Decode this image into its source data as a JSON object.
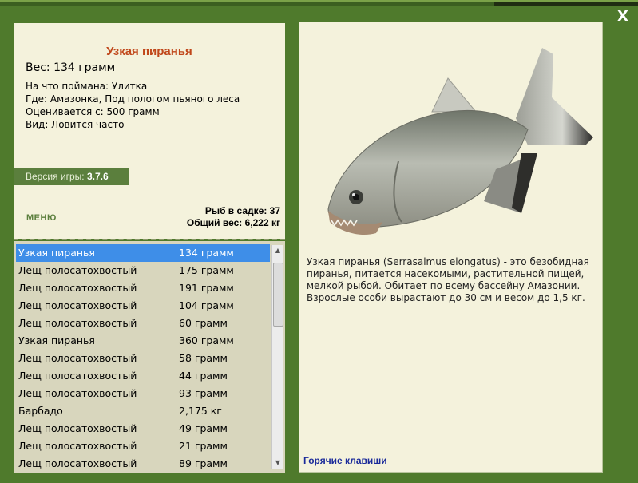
{
  "window": {
    "close_label": "X"
  },
  "fish": {
    "title": "Узкая пиранья",
    "weight": "Вес: 134 грамм",
    "lines": [
      "На что поймана: Улитка",
      "Где: Амазонка, Под пологом пьяного леса",
      "Оценивается с: 500 грамм",
      "Вид: Ловится часто"
    ]
  },
  "version": {
    "label": "Версия игры: ",
    "value": "3.7.6"
  },
  "menu_label": "МЕНЮ",
  "stats": {
    "fish_in_keepnet": "Рыб в садке: 37",
    "total_weight": "Общий вес: 6,222 кг"
  },
  "catch_list": [
    {
      "name": "Узкая пиранья",
      "weight": "134 грамм",
      "selected": true
    },
    {
      "name": "Лещ полосатохвостый",
      "weight": "175 грамм"
    },
    {
      "name": "Лещ полосатохвостый",
      "weight": "191 грамм"
    },
    {
      "name": "Лещ полосатохвостый",
      "weight": "104 грамм"
    },
    {
      "name": "Лещ полосатохвостый",
      "weight": "60 грамм"
    },
    {
      "name": "Узкая пиранья",
      "weight": "360 грамм"
    },
    {
      "name": "Лещ полосатохвостый",
      "weight": "58 грамм"
    },
    {
      "name": "Лещ полосатохвостый",
      "weight": "44 грамм"
    },
    {
      "name": "Лещ полосатохвостый",
      "weight": "93 грамм"
    },
    {
      "name": "Барбадо",
      "weight": "2,175 кг"
    },
    {
      "name": "Лещ полосатохвостый",
      "weight": "49 грамм"
    },
    {
      "name": "Лещ полосатохвостый",
      "weight": "21 грамм"
    },
    {
      "name": "Лещ полосатохвостый",
      "weight": "89 грамм"
    }
  ],
  "description": "Узкая пиранья (Serrasalmus elongatus) - это безобидная пиранья, питается насекомыми, растительной пищей, мелкой рыбой. Обитает по всему бассейну Амазонии. Взрослые особи вырастают до 30 см и весом до 1,5 кг.",
  "hotkeys_label": "Горячие клавиши",
  "colors": {
    "title": "#c0471a",
    "panel_bg": "#f4f2dc",
    "frame_green": "#4f7a2c",
    "selection": "#3e8ee8",
    "link": "#1a2a9a"
  }
}
